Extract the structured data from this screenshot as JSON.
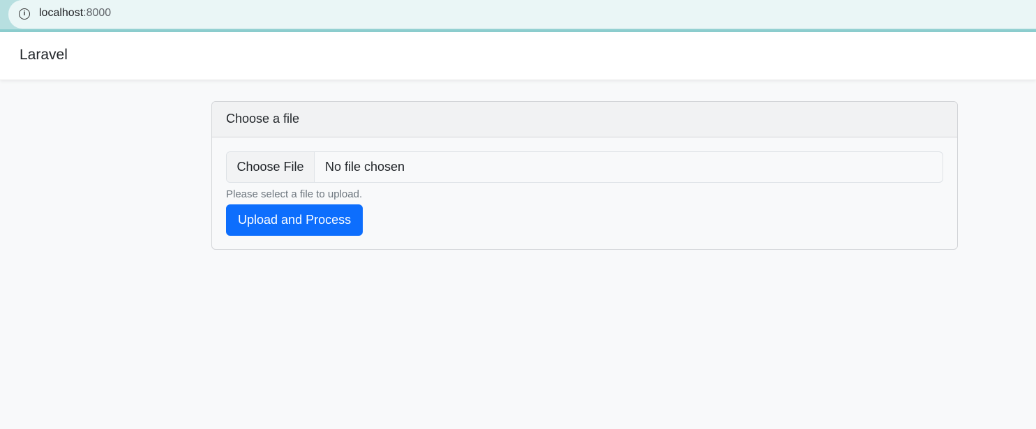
{
  "browser": {
    "url_host": "localhost",
    "url_port": ":8000",
    "info_icon_glyph": "i"
  },
  "navbar": {
    "brand": "Laravel"
  },
  "upload_card": {
    "header": "Choose a file",
    "file_button_label": "Choose File",
    "file_status": "No file chosen",
    "help_text": "Please select a file to upload.",
    "submit_label": "Upload and Process"
  },
  "colors": {
    "primary": "#0d6efd",
    "background": "#f8f9fa",
    "address_bar": "#b7dfe0"
  }
}
